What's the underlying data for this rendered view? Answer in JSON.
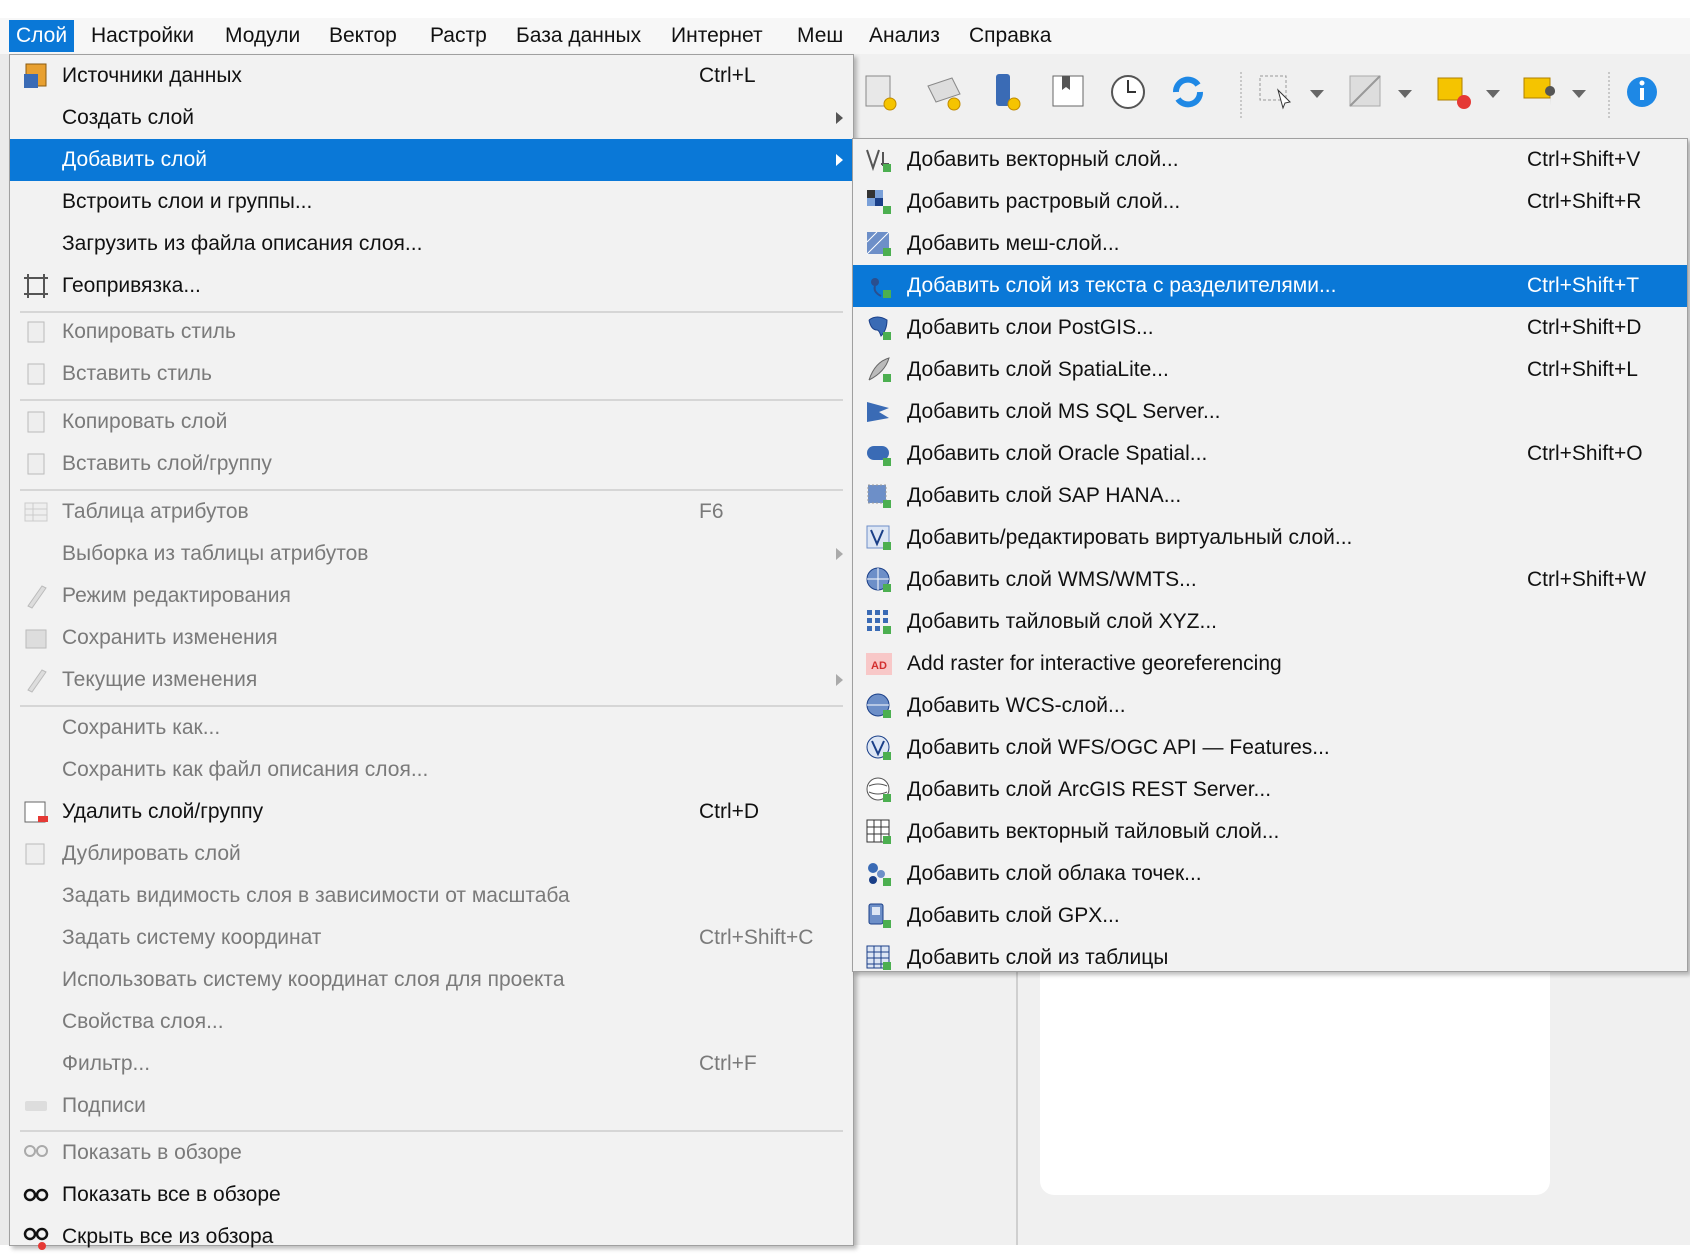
{
  "menubar": {
    "items": [
      "Слой",
      "Настройки",
      "Модули",
      "Вектор",
      "Растр",
      "База данных",
      "Интернет",
      "Меш",
      "Анализ",
      "Справка"
    ]
  },
  "layer_menu": {
    "items": [
      {
        "label": "Источники данных",
        "shortcut": "Ctrl+L",
        "icon": "data-source-manager-icon",
        "disabled": false
      },
      {
        "label": "Создать слой",
        "shortcut": "",
        "submenu": true,
        "disabled": false
      },
      {
        "label": "Добавить слой",
        "shortcut": "",
        "submenu": true,
        "disabled": false,
        "highlighted": true
      },
      {
        "label": "Встроить слои и группы...",
        "shortcut": "",
        "disabled": false
      },
      {
        "label": "Загрузить из файла описания слоя...",
        "shortcut": "",
        "disabled": false
      },
      {
        "label": "Геопривязка...",
        "shortcut": "",
        "icon": "georeferencer-icon",
        "disabled": false
      },
      {
        "label": "Копировать стиль",
        "shortcut": "",
        "icon": "copy-style-icon",
        "disabled": true
      },
      {
        "label": "Вставить стиль",
        "shortcut": "",
        "icon": "paste-style-icon",
        "disabled": true
      },
      {
        "label": "Копировать слой",
        "shortcut": "",
        "icon": "copy-layer-icon",
        "disabled": true
      },
      {
        "label": "Вставить слой/группу",
        "shortcut": "",
        "icon": "paste-layer-icon",
        "disabled": true
      },
      {
        "label": "Таблица атрибутов",
        "shortcut": "F6",
        "icon": "attribute-table-icon",
        "disabled": true
      },
      {
        "label": "Выборка из таблицы атрибутов",
        "shortcut": "",
        "submenu": true,
        "disabled": true
      },
      {
        "label": "Режим редактирования",
        "shortcut": "",
        "icon": "pencil-icon",
        "disabled": true
      },
      {
        "label": "Сохранить изменения",
        "shortcut": "",
        "icon": "save-edits-icon",
        "disabled": true
      },
      {
        "label": "Текущие изменения",
        "shortcut": "",
        "icon": "current-edits-icon",
        "submenu": true,
        "disabled": true
      },
      {
        "label": "Сохранить как...",
        "shortcut": "",
        "disabled": true
      },
      {
        "label": "Сохранить как файл описания слоя...",
        "shortcut": "",
        "disabled": true
      },
      {
        "label": "Удалить слой/группу",
        "shortcut": "Ctrl+D",
        "icon": "remove-layer-icon",
        "disabled": false
      },
      {
        "label": "Дублировать слой",
        "shortcut": "",
        "icon": "duplicate-layer-icon",
        "disabled": true
      },
      {
        "label": "Задать видимость слоя в зависимости от масштаба",
        "shortcut": "",
        "disabled": true
      },
      {
        "label": "Задать систему координат",
        "shortcut": "Ctrl+Shift+C",
        "disabled": true
      },
      {
        "label": "Использовать систему координат слоя для проекта",
        "shortcut": "",
        "disabled": true
      },
      {
        "label": "Свойства слоя...",
        "shortcut": "",
        "disabled": true
      },
      {
        "label": "Фильтр...",
        "shortcut": "Ctrl+F",
        "disabled": true
      },
      {
        "label": "Подписи",
        "shortcut": "",
        "icon": "labels-icon",
        "disabled": true
      },
      {
        "label": "Показать в обзоре",
        "shortcut": "",
        "icon": "overview-add-icon",
        "disabled": true
      },
      {
        "label": "Показать все в обзоре",
        "shortcut": "",
        "icon": "overview-all-icon",
        "disabled": false
      },
      {
        "label": "Скрыть все из обзора",
        "shortcut": "",
        "icon": "overview-hide-icon",
        "disabled": false
      }
    ]
  },
  "add_layer_submenu": {
    "items": [
      {
        "label": "Добавить векторный слой...",
        "shortcut": "Ctrl+Shift+V",
        "icon": "vector-layer-icon"
      },
      {
        "label": "Добавить растровый слой...",
        "shortcut": "Ctrl+Shift+R",
        "icon": "raster-layer-icon"
      },
      {
        "label": "Добавить меш-слой...",
        "shortcut": "",
        "icon": "mesh-layer-icon"
      },
      {
        "label": "Добавить слой из текста с разделителями...",
        "shortcut": "Ctrl+Shift+T",
        "icon": "delimited-text-icon",
        "highlighted": true
      },
      {
        "label": "Добавить слои PostGIS...",
        "shortcut": "Ctrl+Shift+D",
        "icon": "postgis-icon"
      },
      {
        "label": "Добавить слой SpatiaLite...",
        "shortcut": "Ctrl+Shift+L",
        "icon": "spatialite-icon"
      },
      {
        "label": "Добавить слой MS SQL Server...",
        "shortcut": "",
        "icon": "mssql-icon"
      },
      {
        "label": "Добавить слой Oracle Spatial...",
        "shortcut": "Ctrl+Shift+O",
        "icon": "oracle-icon"
      },
      {
        "label": "Добавить слой SAP HANA...",
        "shortcut": "",
        "icon": "sap-hana-icon"
      },
      {
        "label": "Добавить/редактировать виртуальный слой...",
        "shortcut": "",
        "icon": "virtual-layer-icon"
      },
      {
        "label": "Добавить слой WMS/WMTS...",
        "shortcut": "Ctrl+Shift+W",
        "icon": "wms-icon"
      },
      {
        "label": "Добавить тайловый слой XYZ...",
        "shortcut": "",
        "icon": "xyz-tiles-icon"
      },
      {
        "label": "Add raster for interactive georeferencing",
        "shortcut": "",
        "icon": "georef-raster-icon"
      },
      {
        "label": "Добавить WCS-слой...",
        "shortcut": "",
        "icon": "wcs-icon"
      },
      {
        "label": "Добавить слой WFS/OGC API — Features...",
        "shortcut": "",
        "icon": "wfs-icon"
      },
      {
        "label": "Добавить слой ArcGIS REST Server...",
        "shortcut": "",
        "icon": "arcgis-icon"
      },
      {
        "label": "Добавить векторный тайловый слой...",
        "shortcut": "",
        "icon": "vector-tile-icon"
      },
      {
        "label": "Добавить слой облака точек...",
        "shortcut": "",
        "icon": "point-cloud-icon"
      },
      {
        "label": "Добавить слой GPX...",
        "shortcut": "",
        "icon": "gpx-icon"
      },
      {
        "label": "Добавить слой из таблицы",
        "shortcut": "",
        "icon": "table-layer-icon"
      }
    ]
  },
  "colors": {
    "highlight": "#0a78d7",
    "menu_bg": "#f2f2f2",
    "disabled_text": "#7a7a7a"
  }
}
